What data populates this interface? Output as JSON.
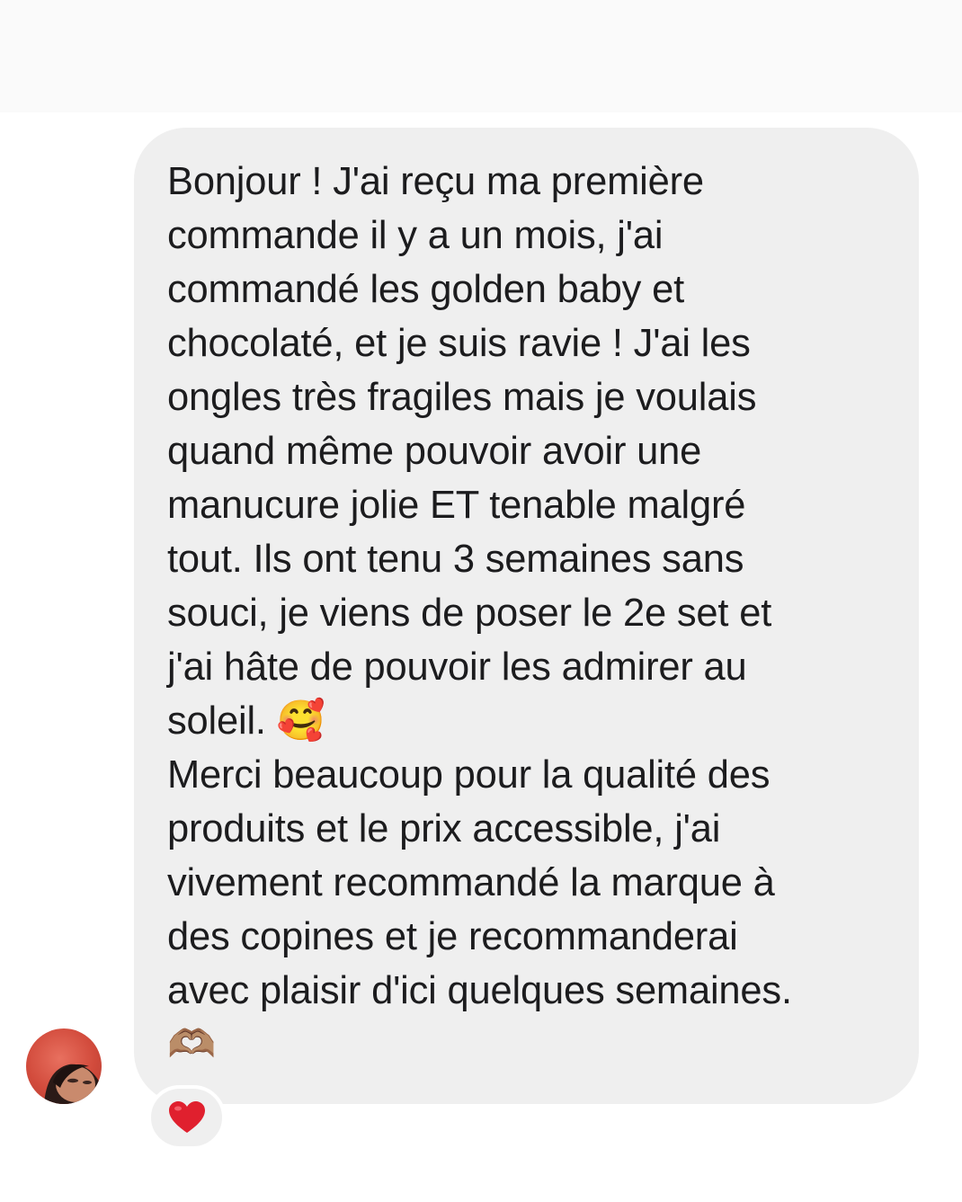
{
  "message": {
    "lines": [
      "Bonjour ! J'ai reçu ma première",
      "commande il y a un mois, j'ai",
      "commandé les golden baby et",
      "chocolaté, et je suis ravie ! J'ai les",
      "ongles très fragiles mais je voulais",
      "quand même pouvoir avoir une",
      "manucure jolie ET tenable malgré",
      "tout. Ils ont tenu 3 semaines sans",
      "souci, je viens de poser le 2e set et",
      "j'ai hâte de pouvoir les admirer au",
      "soleil. 🥰",
      "Merci beaucoup pour la qualité des",
      "produits et le prix accessible, j'ai",
      "vivement recommandé la marque à",
      "des copines et je recommanderai",
      "avec plaisir d'ici quelques semaines.",
      "🫶🏽"
    ]
  },
  "reaction": {
    "icon": "red-heart-icon",
    "emoji": "❤️"
  },
  "avatar": {
    "icon": "user-avatar"
  },
  "colors": {
    "bubble": "#efefef",
    "text": "#1c1c1e",
    "heart": "#e0202e",
    "background": "#ffffff"
  }
}
